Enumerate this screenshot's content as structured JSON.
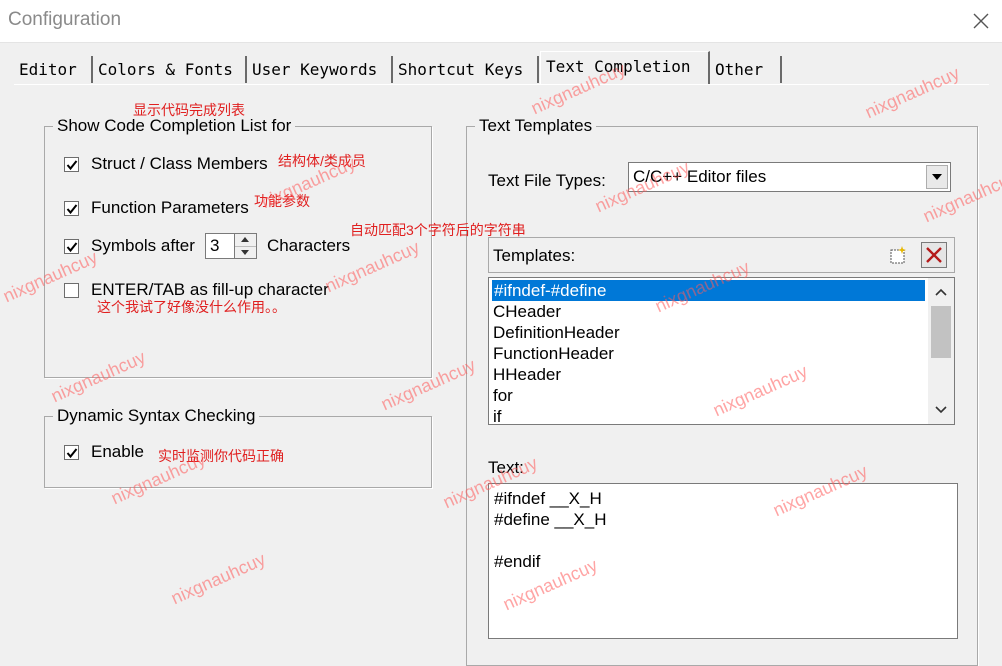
{
  "window": {
    "title": "Configuration"
  },
  "tabs": [
    "Editor",
    "Colors & Fonts",
    "User Keywords",
    "Shortcut Keys",
    "Text Completion",
    "Other"
  ],
  "completion": {
    "legend": "Show Code Completion List for",
    "items": [
      {
        "label": "Struct / Class Members",
        "checked": true
      },
      {
        "label": "Function Parameters",
        "checked": true
      },
      {
        "label": "Symbols after",
        "checked": true
      },
      {
        "label": "ENTER/TAB as fill-up character",
        "checked": false
      }
    ],
    "symbols_value": "3",
    "characters_label": "Characters"
  },
  "syntax": {
    "legend": "Dynamic Syntax Checking",
    "enable_label": "Enable",
    "enable_checked": true
  },
  "templates_group": {
    "legend": "Text Templates",
    "file_types_label": "Text File Types:",
    "file_type_value": "C/C++ Editor files",
    "templates_label": "Templates:",
    "items": [
      "#ifndef-#define",
      "CHeader",
      "DefinitionHeader",
      "FunctionHeader",
      "HHeader",
      "for",
      "if"
    ],
    "selected_index": 0,
    "text_label": "Text:",
    "text_value": "#ifndef __X_H\n#define __X_H\n\n#endif"
  },
  "annotations": {
    "completion_title": "显示代码完成列表",
    "struct_members": "结构体/类成员",
    "function_params": "功能参数",
    "symbols_after": "自动匹配3个字符后的字符串",
    "enter_tab": "这个我试了好像没什么作用。。",
    "realtime": "实时监测你代码正确"
  },
  "watermark": "nixgnauhcuy",
  "colors": {
    "selection": "#0078d7",
    "annotation": "#e02020",
    "watermark": "#ff5a5a"
  }
}
